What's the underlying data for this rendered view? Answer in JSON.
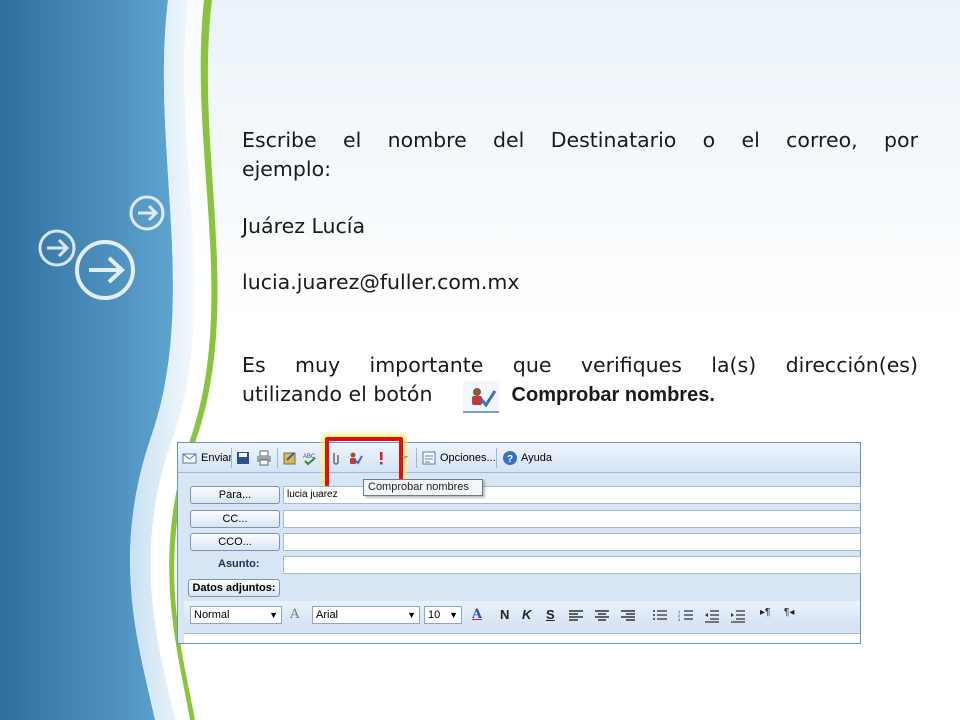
{
  "slide": {
    "paragraph1_line1": "Escribe el nombre del Destinatario o el correo, por",
    "paragraph1_line2": "ejemplo:",
    "example_name": "Juárez Lucía",
    "example_email": "lucia.juarez@fuller.com.mx",
    "paragraph2_line1": "Es muy importante que verifiques la(s) dirección(es)",
    "paragraph2_line2": "utilizando el botón",
    "button_name": "Comprobar nombres."
  },
  "toolbar": {
    "send_label": "Enviar",
    "options_label": "Opciones...",
    "help_label": "Ayuda",
    "tooltip": "Comprobar nombres"
  },
  "fields": {
    "to_label": "Para...",
    "to_value": "lucia juarez",
    "cc_label": "CC...",
    "bcc_label": "CCO...",
    "subject_label": "Asunto:",
    "attach_label": "Datos adjuntos:"
  },
  "format_bar": {
    "style": "Normal",
    "font": "Arial",
    "size": "10",
    "bold": "N",
    "italic": "K",
    "underline": "S"
  },
  "colors": {
    "accent_green": "#8ac43f",
    "highlight_red": "#e01010"
  }
}
